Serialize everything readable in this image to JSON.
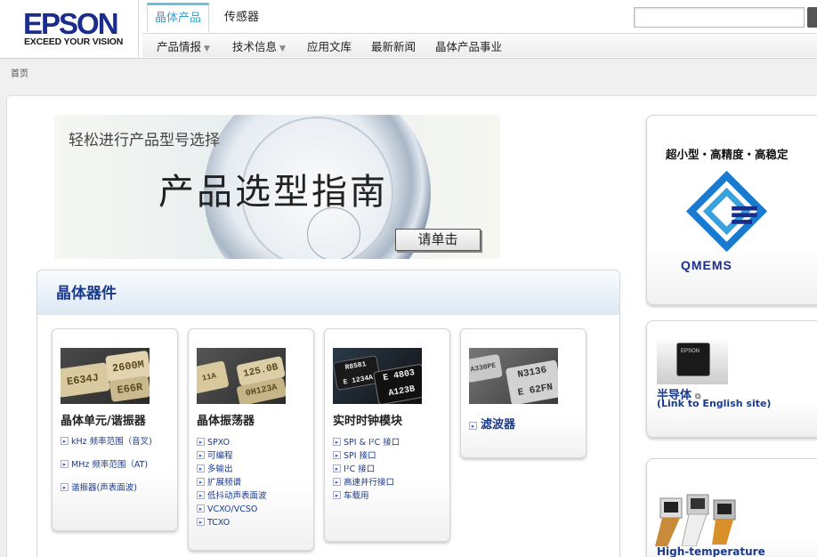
{
  "header": {
    "logo_word": "EPSON",
    "logo_tag": "EXCEED YOUR VISION",
    "tabs": [
      {
        "label": "晶体产品"
      },
      {
        "label": "传感器"
      }
    ],
    "subnav": [
      {
        "label": "产品情报"
      },
      {
        "label": "技术信息"
      },
      {
        "label": "应用文库"
      },
      {
        "label": "最新新闻"
      },
      {
        "label": "晶体产品事业"
      }
    ],
    "caret": "▼",
    "search": {
      "value": "",
      "placeholder": ""
    }
  },
  "breadcrumb": "首页",
  "banner": {
    "subtitle": "轻松进行产品型号选择",
    "title": "产品选型指南",
    "button": "请单击"
  },
  "crystal": {
    "title": "晶体器件",
    "cards": [
      {
        "title": "晶体单元/谐振器",
        "chips": [
          "E634J",
          "2600M",
          "E66R"
        ],
        "items": [
          "kHz 频率范围（音叉)",
          "MHz 频率范围（AT)",
          "谐振器(声表面波)"
        ]
      },
      {
        "title": "晶体振荡器",
        "chips": [
          "11A",
          "125.0B",
          "0H123A"
        ],
        "items": [
          "SPXO",
          "可编程",
          "多输出",
          "扩展频谱",
          "低抖动声表面波",
          "VCXO/VCSO",
          "TCXO"
        ]
      },
      {
        "title": "实时时钟模块",
        "chips": [
          "R8581",
          "E 1234A",
          "E 4803",
          "A123B"
        ],
        "items": [
          "SPI & I²C 接口",
          "SPI 接口",
          "I²C 接口",
          "高速并行接口",
          "车载用"
        ]
      },
      {
        "title": "滤波器",
        "chips": [
          "A330PE",
          "N3136",
          "E 62FN"
        ],
        "items": []
      }
    ]
  },
  "side": {
    "qmems_tagline": "超小型・高精度・高稳定",
    "qmems_word": "QMEMS",
    "semi_title": "半导体",
    "semi_link": "(Link to English site)",
    "semi_chip_label": "EPSON",
    "hot_title": "High-temperature"
  },
  "colors": {
    "brand": "#1a2c8c",
    "link": "#1a3a8c",
    "tab_accent": "#3aa0c8"
  }
}
